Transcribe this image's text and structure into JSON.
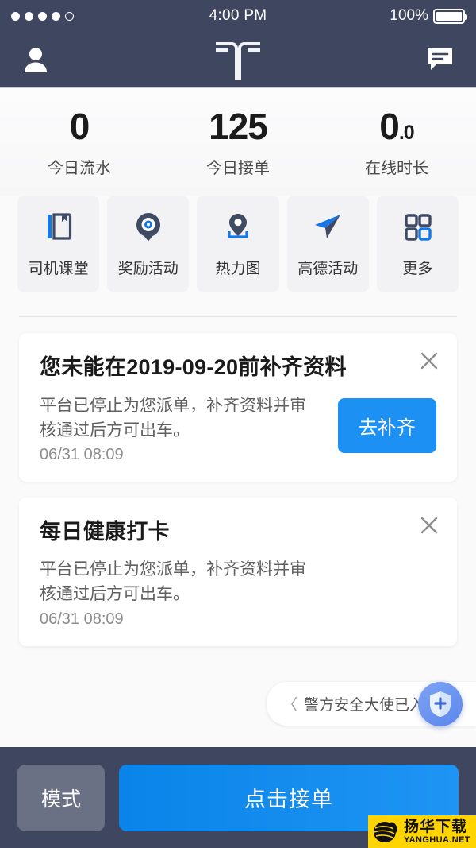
{
  "statusbar": {
    "signal_filled": 4,
    "signal_total": 5,
    "time": "4:00 PM",
    "battery": "100%"
  },
  "navbar": {
    "profile_icon": "person-icon",
    "logo_icon": "t3-logo-icon",
    "message_icon": "chat-bubble-icon"
  },
  "stats": [
    {
      "value": "0",
      "decimal": "",
      "label": "今日流水"
    },
    {
      "value": "125",
      "decimal": "",
      "label": "今日接单"
    },
    {
      "value": "0",
      "decimal": ".0",
      "label": "在线时长"
    }
  ],
  "tiles": [
    {
      "label": "司机课堂",
      "icon": "book-icon"
    },
    {
      "label": "奖励活动",
      "icon": "target-badge-icon"
    },
    {
      "label": "热力图",
      "icon": "map-pin-icon"
    },
    {
      "label": "高德活动",
      "icon": "paper-plane-icon"
    },
    {
      "label": "更多",
      "icon": "grid-icon"
    }
  ],
  "cards": [
    {
      "title": "您未能在2019-09-20前补齐资料",
      "desc": "平台已停止为您派单，补齐资料并审核通过后方可出车。",
      "time": "06/31 08:09",
      "cta": "去补齐",
      "close_icon": "close-icon"
    },
    {
      "title": "每日健康打卡",
      "desc": "平台已停止为您派单，补齐资料并审核通过后方可出车。",
      "time": "06/31 08:09",
      "cta": "",
      "close_icon": "close-icon"
    }
  ],
  "safety_widget": {
    "chevron": "〈",
    "text": "警方安全大使已入驻",
    "fab_icon": "shield-plus-icon"
  },
  "bottombar": {
    "mode_label": "模式",
    "accept_label": "点击接单"
  },
  "watermark": {
    "cn": "扬华下载",
    "en": "YANGHUA.NET"
  },
  "colors": {
    "header": "#3f465f",
    "accent_blue": "#1c90f3",
    "icon_navy": "#3f4a63",
    "icon_blue": "#1677e8",
    "mode_gray": "#6b7185",
    "watermark_yellow": "#ffd400"
  }
}
